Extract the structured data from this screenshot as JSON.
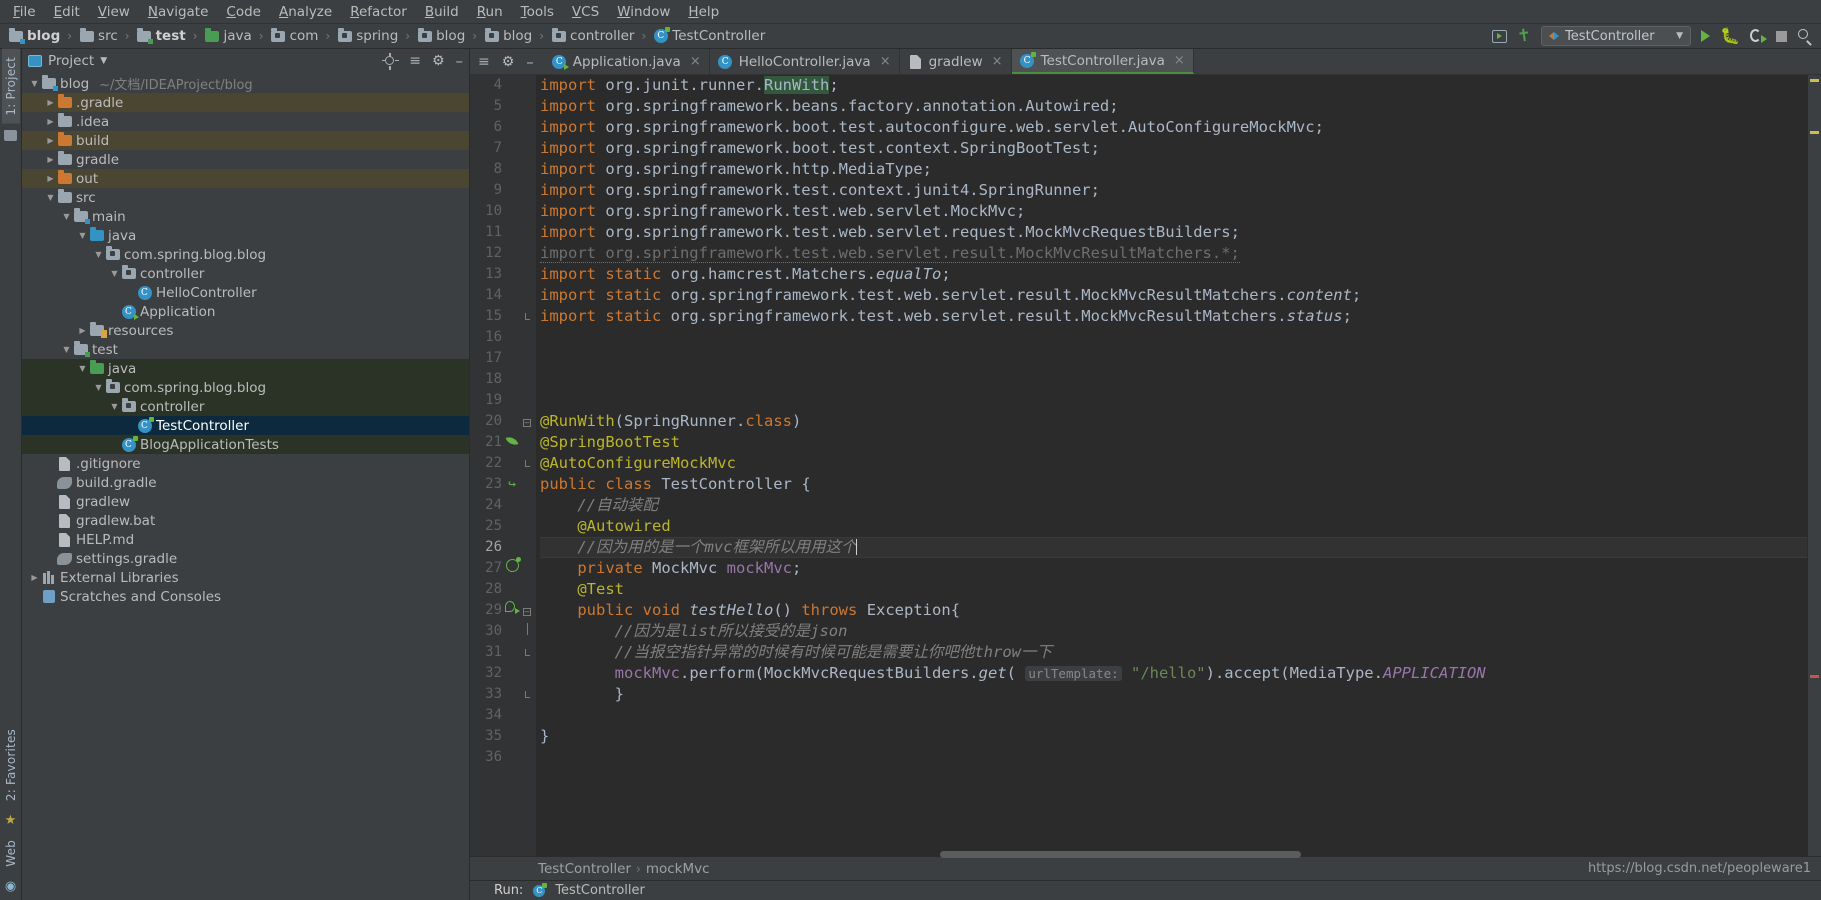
{
  "menu": {
    "items": [
      "File",
      "Edit",
      "View",
      "Navigate",
      "Code",
      "Analyze",
      "Refactor",
      "Build",
      "Run",
      "Tools",
      "VCS",
      "Window",
      "Help"
    ]
  },
  "breadcrumbs": {
    "items": [
      {
        "label": "blog",
        "icon": "module-folder-icon",
        "bold": true
      },
      {
        "label": "src",
        "icon": "folder-icon",
        "bold": false
      },
      {
        "label": "test",
        "icon": "test-source-folder-icon",
        "bold": true
      },
      {
        "label": "java",
        "icon": "green-source-folder-icon",
        "bold": false
      },
      {
        "label": "com",
        "icon": "package-icon",
        "bold": false
      },
      {
        "label": "spring",
        "icon": "package-icon",
        "bold": false
      },
      {
        "label": "blog",
        "icon": "package-icon",
        "bold": false
      },
      {
        "label": "blog",
        "icon": "package-icon",
        "bold": false
      },
      {
        "label": "controller",
        "icon": "package-icon",
        "bold": false
      },
      {
        "label": "TestController",
        "icon": "test-class-icon",
        "bold": false
      }
    ],
    "separator": "›"
  },
  "toolbar_right": {
    "restore_layout_title": "restore-layout",
    "build_title": "build-hammer",
    "run_config": "TestController",
    "run_title": "Run",
    "debug_title": "Debug",
    "run_coverage_title": "Run with Coverage",
    "stop_title": "Stop",
    "search_title": "Search Everywhere"
  },
  "left_strip": {
    "top_tab": "1: Project",
    "bottom_tabs": [
      "2: Favorites",
      "Web"
    ]
  },
  "project_panel": {
    "title": "Project",
    "tree": [
      {
        "indent": 0,
        "arrow": "▼",
        "icon": "module-folder-icon",
        "label": "blog",
        "sub": "~/文档/IDEAProject/blog",
        "state": "normal"
      },
      {
        "indent": 1,
        "arrow": "▶",
        "icon": "folder-orange-icon",
        "label": ".gradle",
        "sub": "",
        "state": "excluded"
      },
      {
        "indent": 1,
        "arrow": "▶",
        "icon": "folder-gray-icon",
        "label": ".idea",
        "sub": "",
        "state": "normal"
      },
      {
        "indent": 1,
        "arrow": "▶",
        "icon": "folder-orange-icon",
        "label": "build",
        "sub": "",
        "state": "excluded"
      },
      {
        "indent": 1,
        "arrow": "▶",
        "icon": "folder-gray-icon",
        "label": "gradle",
        "sub": "",
        "state": "normal"
      },
      {
        "indent": 1,
        "arrow": "▶",
        "icon": "folder-orange-icon",
        "label": "out",
        "sub": "",
        "state": "excluded"
      },
      {
        "indent": 1,
        "arrow": "▼",
        "icon": "folder-gray-icon",
        "label": "src",
        "sub": "",
        "state": "normal"
      },
      {
        "indent": 2,
        "arrow": "▼",
        "icon": "source-folder-icon",
        "label": "main",
        "sub": "",
        "state": "normal"
      },
      {
        "indent": 3,
        "arrow": "▼",
        "icon": "folder-blue-icon",
        "label": "java",
        "sub": "",
        "state": "normal"
      },
      {
        "indent": 4,
        "arrow": "▼",
        "icon": "package-icon",
        "label": "com.spring.blog.blog",
        "sub": "",
        "state": "normal"
      },
      {
        "indent": 5,
        "arrow": "▼",
        "icon": "package-icon",
        "label": "controller",
        "sub": "",
        "state": "normal"
      },
      {
        "indent": 6,
        "arrow": "",
        "icon": "class-icon",
        "label": "HelloController",
        "sub": "",
        "state": "normal"
      },
      {
        "indent": 5,
        "arrow": "",
        "icon": "runnable-class-icon",
        "label": "Application",
        "sub": "",
        "state": "normal"
      },
      {
        "indent": 3,
        "arrow": "▶",
        "icon": "resources-folder-icon",
        "label": "resources",
        "sub": "",
        "state": "normal"
      },
      {
        "indent": 2,
        "arrow": "▼",
        "icon": "test-source-folder-icon",
        "label": "test",
        "sub": "",
        "state": "normal"
      },
      {
        "indent": 3,
        "arrow": "▼",
        "icon": "folder-green-icon",
        "label": "java",
        "sub": "",
        "state": "testroot"
      },
      {
        "indent": 4,
        "arrow": "▼",
        "icon": "package-icon",
        "label": "com.spring.blog.blog",
        "sub": "",
        "state": "testroot"
      },
      {
        "indent": 5,
        "arrow": "▼",
        "icon": "package-icon",
        "label": "controller",
        "sub": "",
        "state": "testroot"
      },
      {
        "indent": 6,
        "arrow": "",
        "icon": "test-class-icon",
        "label": "TestController",
        "sub": "",
        "state": "selected"
      },
      {
        "indent": 5,
        "arrow": "",
        "icon": "test-class-icon",
        "label": "BlogApplicationTests",
        "sub": "",
        "state": "testroot"
      },
      {
        "indent": 1,
        "arrow": "",
        "icon": "file-icon",
        "label": ".gitignore",
        "sub": "",
        "state": "normal"
      },
      {
        "indent": 1,
        "arrow": "",
        "icon": "gradle-icon",
        "label": "build.gradle",
        "sub": "",
        "state": "normal"
      },
      {
        "indent": 1,
        "arrow": "",
        "icon": "file-icon",
        "label": "gradlew",
        "sub": "",
        "state": "normal"
      },
      {
        "indent": 1,
        "arrow": "",
        "icon": "file-icon",
        "label": "gradlew.bat",
        "sub": "",
        "state": "normal"
      },
      {
        "indent": 1,
        "arrow": "",
        "icon": "file-icon",
        "label": "HELP.md",
        "sub": "",
        "state": "normal"
      },
      {
        "indent": 1,
        "arrow": "",
        "icon": "gradle-icon",
        "label": "settings.gradle",
        "sub": "",
        "state": "normal"
      },
      {
        "indent": 0,
        "arrow": "▶",
        "icon": "library-icon",
        "label": "External Libraries",
        "sub": "",
        "state": "normal"
      },
      {
        "indent": 0,
        "arrow": "",
        "icon": "scratches-icon",
        "label": "Scratches and Consoles",
        "sub": "",
        "state": "normal"
      }
    ]
  },
  "editor": {
    "tabs": [
      {
        "label": "Application.java",
        "icon": "runnable-class-icon",
        "active": false
      },
      {
        "label": "HelloController.java",
        "icon": "class-icon",
        "active": false
      },
      {
        "label": "gradlew",
        "icon": "file-icon",
        "active": false
      },
      {
        "label": "TestController.java",
        "icon": "test-class-icon",
        "active": true
      }
    ],
    "first_line": 4,
    "current_line": 26,
    "lines": [
      {
        "n": 4,
        "gmark": "",
        "fold": "",
        "html": "<span class=\"kw\">import</span> <span class=\"plain\">org.junit.runner.</span><span class=\"hl plain\">RunWith</span><span class=\"plain\">;</span>"
      },
      {
        "n": 5,
        "gmark": "",
        "fold": "",
        "html": "<span class=\"kw\">import</span> <span class=\"plain\">org.springframework.beans.factory.annotation.</span><span class=\"cls\">Autowired</span><span class=\"plain\">;</span>"
      },
      {
        "n": 6,
        "gmark": "",
        "fold": "",
        "html": "<span class=\"kw\">import</span> <span class=\"plain\">org.springframework.boot.test.autoconfigure.web.servlet.</span><span class=\"cls\">AutoConfigureMockMvc</span><span class=\"plain\">;</span>"
      },
      {
        "n": 7,
        "gmark": "",
        "fold": "",
        "html": "<span class=\"kw\">import</span> <span class=\"plain\">org.springframework.boot.test.context.</span><span class=\"cls\">SpringBootTest</span><span class=\"plain\">;</span>"
      },
      {
        "n": 8,
        "gmark": "",
        "fold": "",
        "html": "<span class=\"kw\">import</span> <span class=\"plain\">org.springframework.http.</span><span class=\"cls\">MediaType</span><span class=\"plain\">;</span>"
      },
      {
        "n": 9,
        "gmark": "",
        "fold": "",
        "html": "<span class=\"kw\">import</span> <span class=\"plain\">org.springframework.test.context.junit4.</span><span class=\"cls\">SpringRunner</span><span class=\"plain\">;</span>"
      },
      {
        "n": 10,
        "gmark": "",
        "fold": "",
        "html": "<span class=\"kw\">import</span> <span class=\"plain\">org.springframework.test.web.servlet.</span><span class=\"cls\">MockMvc</span><span class=\"plain\">;</span>"
      },
      {
        "n": 11,
        "gmark": "",
        "fold": "",
        "html": "<span class=\"kw\">import</span> <span class=\"plain\">org.springframework.test.web.servlet.request.</span><span class=\"cls\">MockMvcRequestBuilders</span><span class=\"plain\">;</span>"
      },
      {
        "n": 12,
        "gmark": "",
        "fold": "",
        "html": "<span class=\"unused\">import org.springframework.test.web.servlet.result.MockMvcResultMatchers.*;</span>"
      },
      {
        "n": 13,
        "gmark": "",
        "fold": "",
        "html": "<span class=\"kw\">import static</span> <span class=\"plain\">org.hamcrest.Matchers.</span><span class=\"statc\">equalTo</span><span class=\"plain\">;</span>"
      },
      {
        "n": 14,
        "gmark": "",
        "fold": "",
        "html": "<span class=\"kw\">import static</span> <span class=\"plain\">org.springframework.test.web.servlet.result.MockMvcResultMatchers.</span><span class=\"statc\">content</span><span class=\"plain\">;</span>"
      },
      {
        "n": 15,
        "gmark": "",
        "fold": "fold-end",
        "html": "<span class=\"kw\">import static</span> <span class=\"plain\">org.springframework.test.web.servlet.result.MockMvcResultMatchers.</span><span class=\"statc\">status</span><span class=\"plain\">;</span>"
      },
      {
        "n": 16,
        "gmark": "",
        "fold": "",
        "html": ""
      },
      {
        "n": 17,
        "gmark": "",
        "fold": "",
        "html": ""
      },
      {
        "n": 18,
        "gmark": "",
        "fold": "",
        "html": ""
      },
      {
        "n": 19,
        "gmark": "",
        "fold": "",
        "html": ""
      },
      {
        "n": 20,
        "gmark": "",
        "fold": "fold-top",
        "html": "<span class=\"ann\">@RunWith</span><span class=\"plain\">(</span><span class=\"cls\">SpringRunner</span><span class=\"plain\">.</span><span class=\"kw\">class</span><span class=\"plain\">)</span>"
      },
      {
        "n": 21,
        "gmark": "leaf-icon",
        "fold": "",
        "html": "<span class=\"ann\">@SpringBootTest</span>"
      },
      {
        "n": 22,
        "gmark": "",
        "fold": "fold-bottom",
        "html": "<span class=\"ann\">@AutoConfigureMockMvc</span>"
      },
      {
        "n": 23,
        "gmark": "impl-arrow-icon",
        "fold": "",
        "html": "<span class=\"kw\">public class</span> <span class=\"cls\">TestController</span> <span class=\"plain\">{</span>"
      },
      {
        "n": 24,
        "gmark": "",
        "fold": "",
        "html": "    <span class=\"cmt\">//自动装配</span>"
      },
      {
        "n": 25,
        "gmark": "",
        "fold": "",
        "html": "    <span class=\"ann\">@Autowired</span>"
      },
      {
        "n": 26,
        "gmark": "",
        "fold": "",
        "html": "    <span class=\"cmt\">//因为用的是一个mvc框架所以用用这个</span><span class=\"caret-bar\"></span>"
      },
      {
        "n": 27,
        "gmark": "bean-icon",
        "fold": "",
        "html": "    <span class=\"kw\">private</span> <span class=\"cls\">MockMvc</span> <span class=\"fld\">mockMvc</span><span class=\"plain\">;</span>"
      },
      {
        "n": 28,
        "gmark": "",
        "fold": "",
        "html": "    <span class=\"ann\">@Test</span>"
      },
      {
        "n": 29,
        "gmark": "run-test-icon",
        "fold": "fold-top",
        "html": "    <span class=\"kw\">public void</span> <span class=\"mth\">testHello</span><span class=\"plain\">()</span> <span class=\"kw\">throws</span> <span class=\"cls\">Exception</span><span class=\"plain\">{</span>"
      },
      {
        "n": 30,
        "gmark": "",
        "fold": "fold-mid",
        "html": "        <span class=\"cmt\">//因为是list所以接受的是json</span>"
      },
      {
        "n": 31,
        "gmark": "",
        "fold": "fold-bottom",
        "html": "        <span class=\"cmt\">//当报空指针异常的时候有时候可能是需要让你吧他throw一下</span>"
      },
      {
        "n": 32,
        "gmark": "",
        "fold": "",
        "html": "        <span class=\"fld\">mockMvc</span><span class=\"plain\">.perform(</span><span class=\"cls\">MockMvcRequestBuilders</span><span class=\"plain\">.</span><span class=\"statc\">get</span><span class=\"plain\">(</span> <span class=\"hint\">urlTemplate:</span> <span class=\"str\">\"/hello\"</span><span class=\"plain\">).accept(</span><span class=\"cls\">MediaType</span><span class=\"plain\">.</span><span class=\"constf\">APPLICATION</span>"
      },
      {
        "n": 33,
        "gmark": "",
        "fold": "fold-end",
        "html": "        <span class=\"plain\">}</span>"
      },
      {
        "n": 34,
        "gmark": "",
        "fold": "",
        "html": ""
      },
      {
        "n": 35,
        "gmark": "",
        "fold": "",
        "html": "<span class=\"plain\">}</span>"
      },
      {
        "n": 36,
        "gmark": "",
        "fold": "",
        "html": ""
      }
    ]
  },
  "bottom_breadcrumb": {
    "items": [
      "TestController",
      "mockMvc"
    ],
    "separator": "›",
    "watermark": "https://blog.csdn.net/peopleware1"
  },
  "statusbar": {
    "run_label": "Run:",
    "run_target": "TestController"
  },
  "colors": {
    "accent_blue": "#3592c4",
    "selection": "#0d293e",
    "test_root": "#2b3327",
    "excluded": "#4b4632",
    "keyword_orange": "#cc7832",
    "string_green": "#6a8759",
    "annotation_yellow": "#bbb529",
    "field_purple": "#9876aa",
    "green_run": "#62b543"
  }
}
